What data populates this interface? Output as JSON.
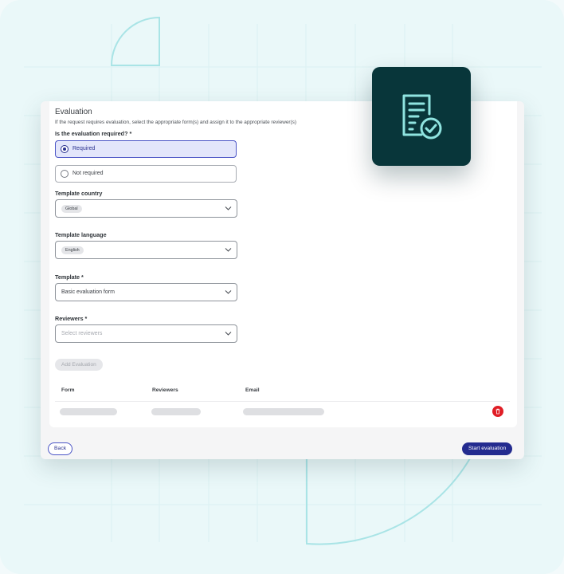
{
  "evaluation": {
    "title": "Evaluation",
    "subtitle": "If the request requires evaluation, select the appropriate form(s) and assign it to the appropriate reviewer(s)",
    "question": "Is the evaluation required? *",
    "options": [
      {
        "label": "Required",
        "selected": true
      },
      {
        "label": "Not required",
        "selected": false
      }
    ],
    "template_country": {
      "label": "Template country",
      "value": "Global"
    },
    "template_language": {
      "label": "Template language",
      "value": "English"
    },
    "template": {
      "label": "Template  *",
      "value": "Basic evaluation form"
    },
    "reviewers": {
      "label": "Reviewers  *",
      "placeholder": "Select reviewers"
    },
    "add_button": "Add Evaluation",
    "table": {
      "headers": [
        "Form",
        "Reviewers",
        "Email"
      ],
      "rows": [
        {
          "loading": true
        }
      ]
    }
  },
  "footer": {
    "back_label": "Back",
    "start_label": "Start evaluation"
  },
  "icons": {
    "badge": "document-check-icon",
    "delete": "trash-icon",
    "dropdown": "chevron-down-icon"
  },
  "colors": {
    "accent": "#232b8f",
    "selected_bg": "#e3e6fb",
    "badge_bg": "#08363a",
    "badge_icon": "#8fe4e0",
    "danger": "#e01e26",
    "background": "#eaf8f9"
  }
}
